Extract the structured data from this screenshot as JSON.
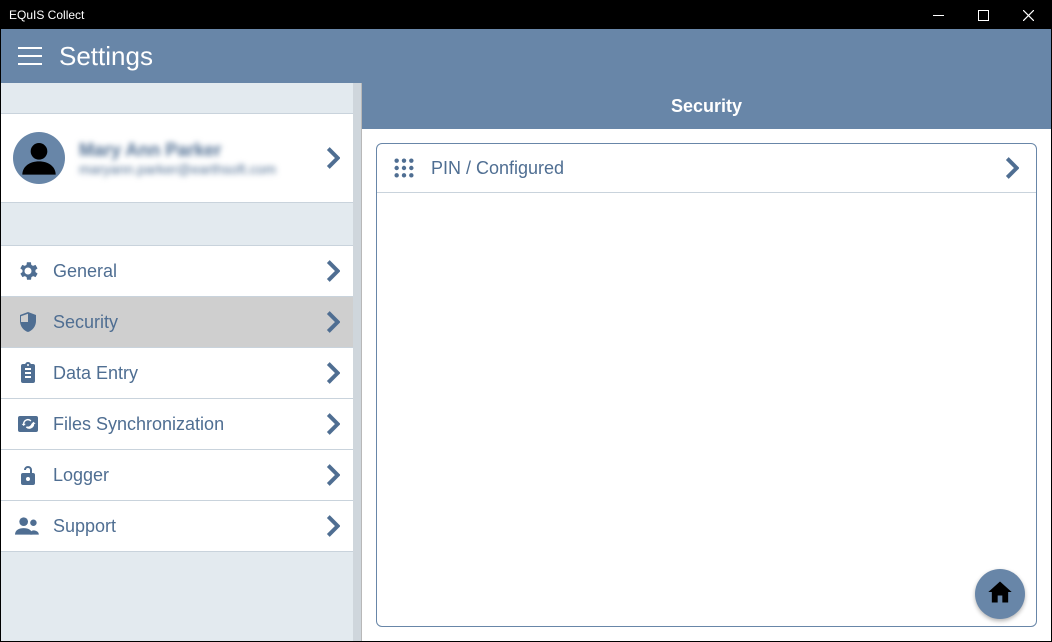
{
  "window": {
    "title": "EQuIS Collect"
  },
  "header": {
    "title": "Settings"
  },
  "profile": {
    "name": "Mary Ann Parker",
    "email": "maryann.parker@earthsoft.com"
  },
  "sidebar": {
    "items": [
      {
        "label": "General"
      },
      {
        "label": "Security"
      },
      {
        "label": "Data Entry"
      },
      {
        "label": "Files Synchronization"
      },
      {
        "label": "Logger"
      },
      {
        "label": "Support"
      }
    ]
  },
  "main": {
    "title": "Security",
    "items": [
      {
        "label": "PIN / Configured"
      }
    ]
  }
}
